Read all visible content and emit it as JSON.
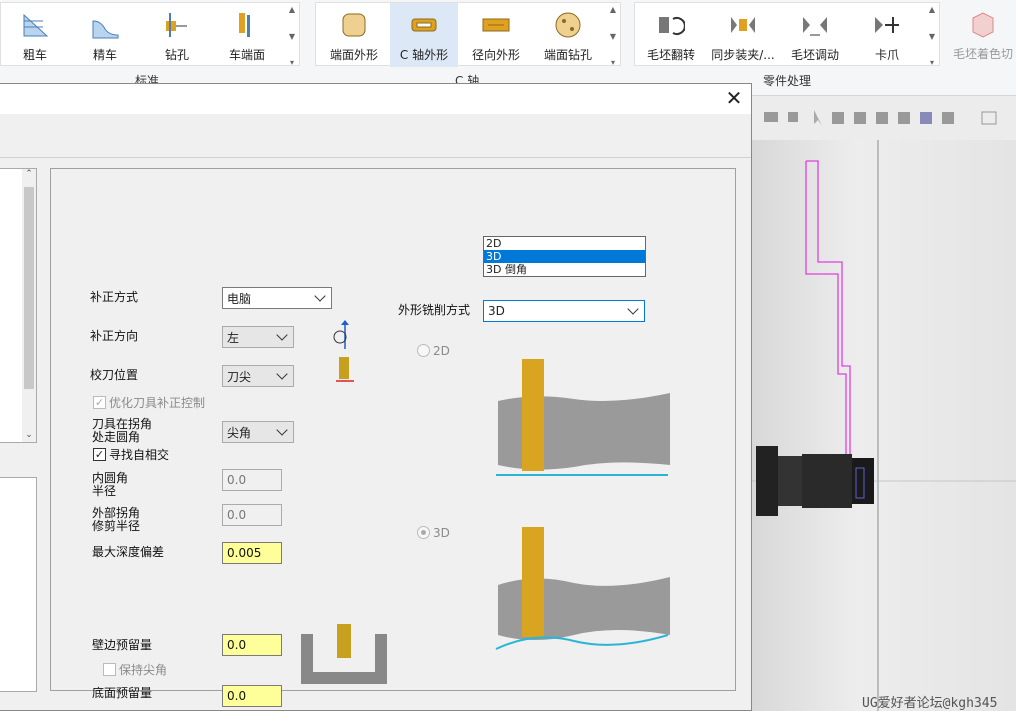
{
  "ribbon": {
    "groups": [
      {
        "label": "标准"
      },
      {
        "label": "C 轴"
      },
      {
        "label": "零件处理"
      }
    ],
    "buttons": [
      "粗车",
      "精车",
      "钻孔",
      "车端面",
      "端面外形",
      "C 轴外形",
      "径向外形",
      "端面钻孔",
      "毛坯翻转",
      "同步装夹/...",
      "毛坯调动",
      "卡爪",
      "毛坯着色切"
    ]
  },
  "dialog": {
    "fields": {
      "comp_mode_label": "补正方式",
      "comp_mode_value": "电脑",
      "comp_dir_label": "补正方向",
      "comp_dir_value": "左",
      "tool_pos_label": "校刀位置",
      "tool_pos_value": "刀尖",
      "optimize_label": "优化刀具补正控制",
      "corner_label_1": "刀具在拐角",
      "corner_label_2": "处走圆角",
      "corner_value": "尖角",
      "self_intersect_label": "寻找自相交",
      "inner_radius_label_1": "内圆角",
      "inner_radius_label_2": "半径",
      "inner_radius_value": "0.0",
      "outer_radius_label_1": "外部拐角",
      "outer_radius_label_2": "修剪半径",
      "outer_radius_value": "0.0",
      "max_depth_label": "最大深度偏差",
      "max_depth_value": "0.005",
      "wall_stock_label": "壁边预留量",
      "wall_stock_value": "0.0",
      "keep_sharp_label": "保持尖角",
      "floor_stock_label": "底面预留量",
      "floor_stock_value": "0.0",
      "contour_mode_label": "外形铣削方式",
      "contour_mode_value": "3D",
      "contour_options": [
        "2D",
        "3D",
        "3D 倒角"
      ],
      "radio_2d_label": "2D",
      "radio_3d_label": "3D"
    }
  },
  "watermark": "UG爱好者论坛@kgh345",
  "colors": {
    "accent": "#0078d7",
    "highlight": "#ffff99",
    "path": "#e040e0"
  }
}
